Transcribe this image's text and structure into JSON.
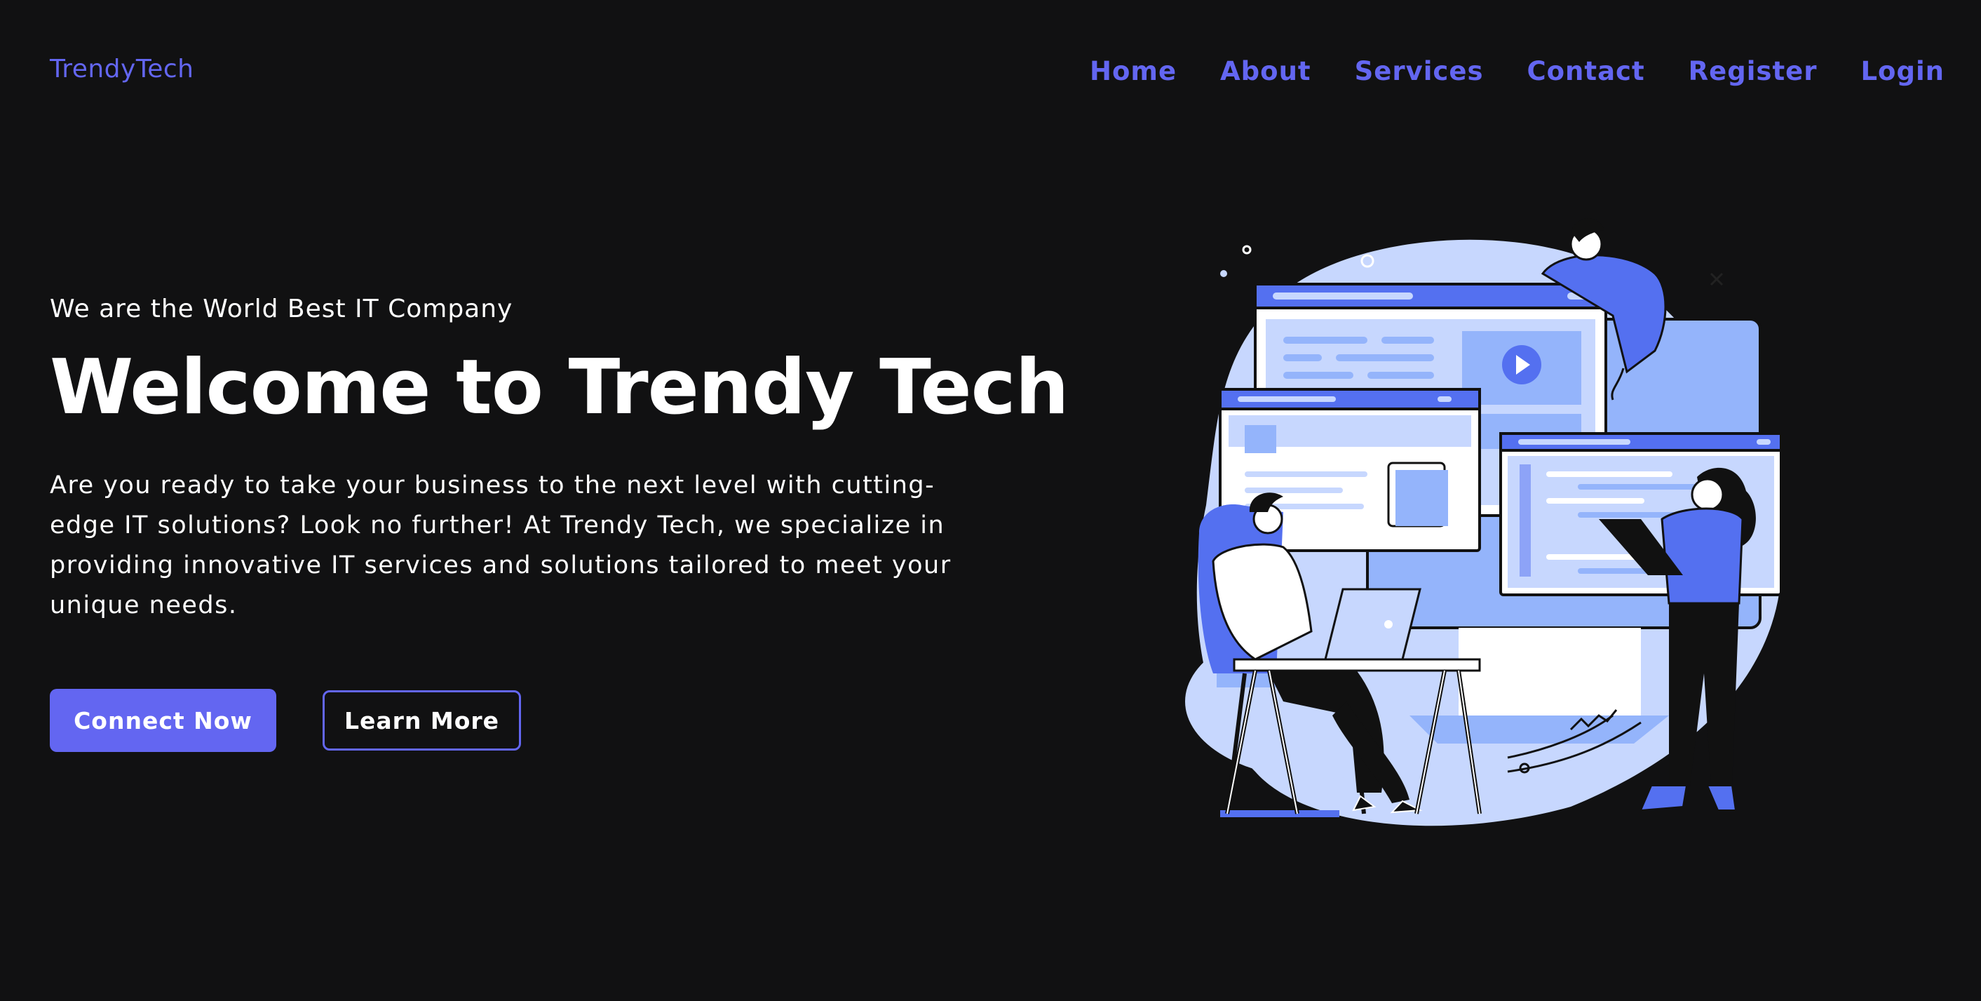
{
  "header": {
    "logo": "TrendyTech",
    "nav": [
      "Home",
      "About",
      "Services",
      "Contact",
      "Register",
      "Login"
    ]
  },
  "hero": {
    "tagline": "We are the World Best IT Company",
    "title": "Welcome to Trendy Tech",
    "description": "Are you ready to take your business to the next level with cutting-edge IT solutions? Look no further! At Trendy Tech, we specialize in providing innovative IT services and solutions tailored to meet your unique needs.",
    "primary_button": "Connect Now",
    "secondary_button": "Learn More"
  },
  "colors": {
    "background": "#111112",
    "accent": "#6366f1",
    "text": "#ffffff",
    "illustration_light": "#c7d7fe",
    "illustration_mid": "#94b4fb",
    "illustration_dark": "#5470f0"
  },
  "icons": {
    "play": "play-icon"
  }
}
